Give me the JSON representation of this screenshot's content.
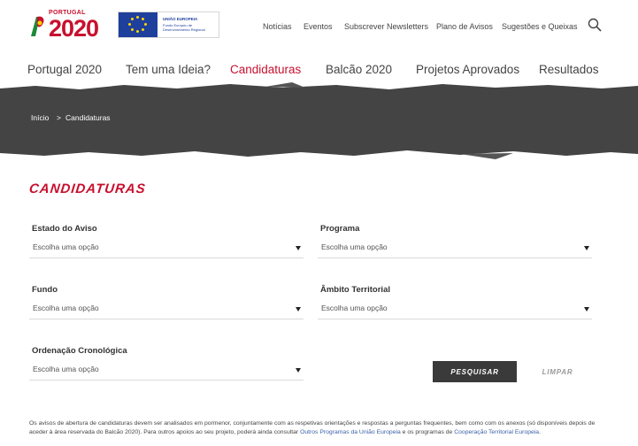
{
  "header": {
    "logo_portugal": "PORTUGAL",
    "logo_year": "2020",
    "eu_title": "UNIÃO EUROPEIA",
    "eu_subtitle": "Fundo Europeu de Desenvolvimento Regional",
    "top_links": [
      "Notícias",
      "Eventos",
      "Subscrever Newsletters",
      "Plano de Avisos",
      "Sugestões e Queixas"
    ],
    "search_icon": "search-icon"
  },
  "nav": {
    "items": [
      "Portugal 2020",
      "Tem uma Ideia?",
      "Candidaturas",
      "Balcão 2020",
      "Projetos Aprovados",
      "Resultados"
    ],
    "active": "Candidaturas"
  },
  "breadcrumb": {
    "home": "Início",
    "separator": ">",
    "current": "Candidaturas"
  },
  "page": {
    "title": "CANDIDATURAS"
  },
  "form": {
    "estado": {
      "label": "Estado do Aviso",
      "value": "Escolha uma opção"
    },
    "programa": {
      "label": "Programa",
      "value": "Escolha uma opção"
    },
    "fundo": {
      "label": "Fundo",
      "value": "Escolha uma opção"
    },
    "ambito": {
      "label": "Âmbito Territorial",
      "value": "Escolha uma opção"
    },
    "ordenacao": {
      "label": "Ordenação Cronológica",
      "value": "Escolha uma opção"
    },
    "search_label": "PESQUISAR",
    "clear_label": "LIMPAR"
  },
  "notice": {
    "text_part1": "Os avisos de abertura de candidaturas devem ser analisados em pormenor, conjuntamente com as respetivas orientações e respostas a perguntas frequentes, bem como com os anexos (só disponíveis depois de aceder à área reservada do Balcão 2020). Para outros apoios ao seu projeto, poderá ainda consultar ",
    "link1": "Outros Programas da União Europeia",
    "text_part2": " e os programas de ",
    "link2": "Cooperação Territorial Europeia",
    "text_part3": "."
  },
  "colors": {
    "brand_red": "#c8102e",
    "banner_dark": "#444444",
    "link_blue": "#3a5fa6"
  }
}
